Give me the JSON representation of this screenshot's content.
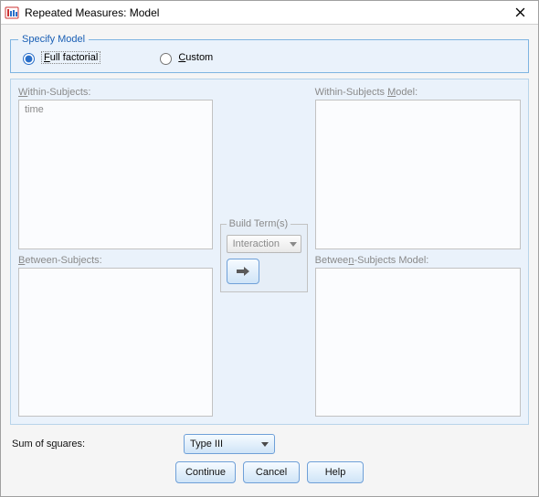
{
  "window": {
    "title": "Repeated Measures: Model"
  },
  "specify": {
    "legend": "Specify Model",
    "full_factorial": "Full factorial",
    "custom": "Custom",
    "selected": "full_factorial"
  },
  "labels": {
    "within_subjects": "Within-Subjects:",
    "between_subjects": "Between-Subjects:",
    "within_subjects_model": "Within-Subjects Model:",
    "between_subjects_model": "Between-Subjects Model:"
  },
  "lists": {
    "within_subjects": [
      "time"
    ],
    "between_subjects": [],
    "within_model": [],
    "between_model": []
  },
  "build_terms": {
    "legend": "Build Term(s)",
    "type": "Interaction"
  },
  "sum_of_squares": {
    "label": "Sum of squares:",
    "value": "Type III"
  },
  "buttons": {
    "continue": "Continue",
    "cancel": "Cancel",
    "help": "Help"
  }
}
